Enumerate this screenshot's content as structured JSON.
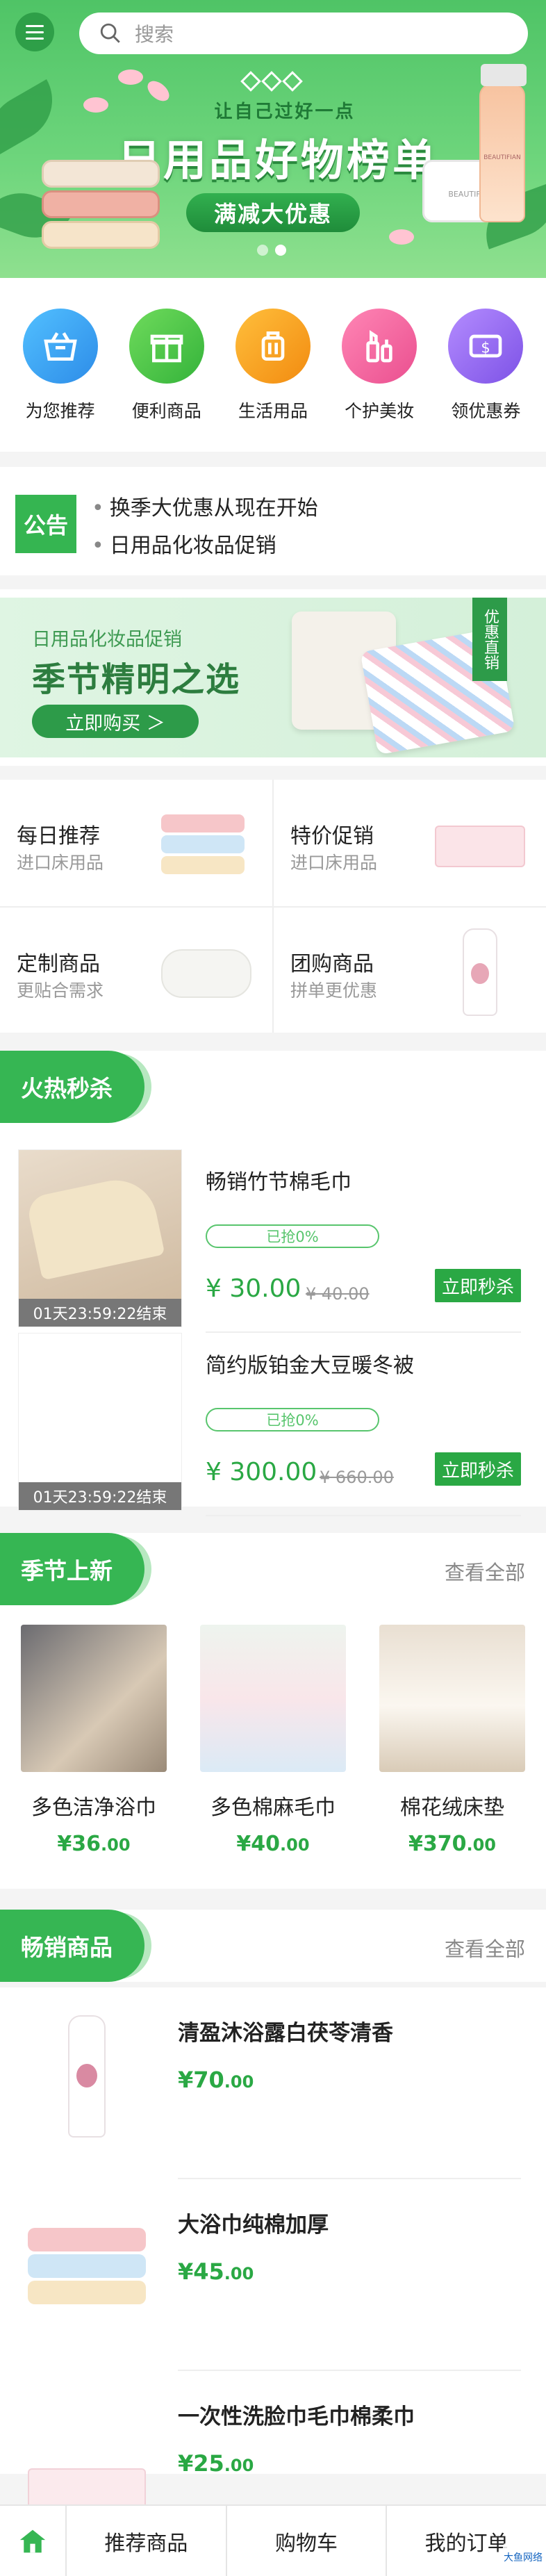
{
  "search": {
    "placeholder": "搜索"
  },
  "banner": {
    "subtitle": "让自己过好一点",
    "title": "日用品好物榜单",
    "pill": "满减大优惠",
    "bottle_label_1": "BEAUTIFIAN",
    "bottle_label_2": "BEAUTIFIAN"
  },
  "categories": [
    {
      "label": "为您推荐",
      "color": "#3aa8f0",
      "icon": "basket-icon"
    },
    {
      "label": "便利商品",
      "color": "#4cc84a",
      "icon": "gift-icon"
    },
    {
      "label": "生活用品",
      "color": "#f7a21b",
      "icon": "luggage-icon"
    },
    {
      "label": "个护美妆",
      "color": "#f06aa0",
      "icon": "cosmetics-icon"
    },
    {
      "label": "领优惠券",
      "color": "#9a6cf0",
      "icon": "coupon-icon"
    }
  ],
  "notice": {
    "tag": "公告",
    "lines": [
      "换季大优惠从现在开始",
      "日用品化妆品促销"
    ]
  },
  "promo": {
    "line1": "日用品化妆品促销",
    "line2": "季节精明之选",
    "button": "立即购买 ＞",
    "ribbon": "优惠直销"
  },
  "grid": [
    {
      "title": "每日推荐",
      "sub": "进口床用品"
    },
    {
      "title": "特价促销",
      "sub": "进口床用品"
    },
    {
      "title": "定制商品",
      "sub": "更贴合需求"
    },
    {
      "title": "团购商品",
      "sub": "拼单更优惠"
    }
  ],
  "flash_sale": {
    "heading": "火热秒杀",
    "items": [
      {
        "name": "畅销竹节棉毛巾",
        "progress": "已抢0%",
        "price": "¥ 30.00",
        "old": "¥ 40.00",
        "button": "立即秒杀",
        "timer": "01天23:59:22结束"
      },
      {
        "name": "简约版铂金大豆暖冬被",
        "progress": "已抢0%",
        "price": "¥ 300.00",
        "old": "¥ 660.00",
        "button": "立即秒杀",
        "timer": "01天23:59:22结束"
      }
    ]
  },
  "new_arrivals": {
    "heading": "季节上新",
    "view_all": "查看全部",
    "items": [
      {
        "name": "多色洁净浴巾",
        "currency": "¥",
        "price": "36",
        "cents": ".00"
      },
      {
        "name": "多色棉麻毛巾",
        "currency": "¥",
        "price": "40",
        "cents": ".00"
      },
      {
        "name": "棉花绒床垫",
        "currency": "¥",
        "price": "370",
        "cents": ".00"
      }
    ]
  },
  "best_sellers": {
    "heading": "畅销商品",
    "view_all": "查看全部",
    "items": [
      {
        "name": "清盈沐浴露白茯苓清香",
        "currency": "¥",
        "price": "70",
        "cents": ".00"
      },
      {
        "name": "大浴巾纯棉加厚",
        "currency": "¥",
        "price": "45",
        "cents": ".00"
      },
      {
        "name": "一次性洗脸巾毛巾棉柔巾",
        "currency": "¥",
        "price": "25",
        "cents": ".00"
      }
    ]
  },
  "tabbar": {
    "tabs": [
      "推荐商品",
      "购物车",
      "我的订单"
    ]
  },
  "watermark": "大鱼网络",
  "colors": {
    "brand_green": "#36b653",
    "price_green": "#2aa844"
  }
}
